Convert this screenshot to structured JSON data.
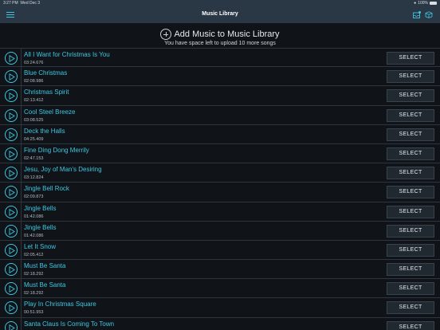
{
  "status_bar": {
    "time": "3:27 PM",
    "day": "Wed Dec 3",
    "battery": "100%"
  },
  "navbar": {
    "title": "Music Library",
    "menu_icon": "hamburger-menu-icon",
    "right_icons": [
      "inbox-icon",
      "box-icon"
    ]
  },
  "header": {
    "add_label": "Add Music to Music Library",
    "subtext": "You have space left to upload 10 more songs"
  },
  "colors": {
    "accent": "#3ec6e0",
    "background": "#101419",
    "navbar": "#2a3845"
  },
  "select_label": "SELECT",
  "songs": [
    {
      "title": "All I Want for Christmas Is You",
      "duration": "03:24.676"
    },
    {
      "title": "Blue Christmas",
      "duration": "02:08.986"
    },
    {
      "title": "Christmas Spirit",
      "duration": "02:13.412"
    },
    {
      "title": "Cool Steel Breeze",
      "duration": "03:08.525"
    },
    {
      "title": "Deck the Halls",
      "duration": "04:25.409"
    },
    {
      "title": "Fine Ding Dong Merrily",
      "duration": "02:47.153"
    },
    {
      "title": "Jesu, Joy of Man's Desiring",
      "duration": "03:12.824"
    },
    {
      "title": "Jingle Bell Rock",
      "duration": "02:09.873"
    },
    {
      "title": "Jingle Bells",
      "duration": "01:42.086"
    },
    {
      "title": "Jingle Bells",
      "duration": "01:42.086"
    },
    {
      "title": "Let It Snow",
      "duration": "02:05.412"
    },
    {
      "title": "Must Be Santa",
      "duration": "02:18.292"
    },
    {
      "title": "Must Be Santa",
      "duration": "02:18.292"
    },
    {
      "title": "Play In Christmas Square",
      "duration": "00:51.953"
    },
    {
      "title": "Santa Claus Is Coming To Town",
      "duration": ""
    }
  ]
}
